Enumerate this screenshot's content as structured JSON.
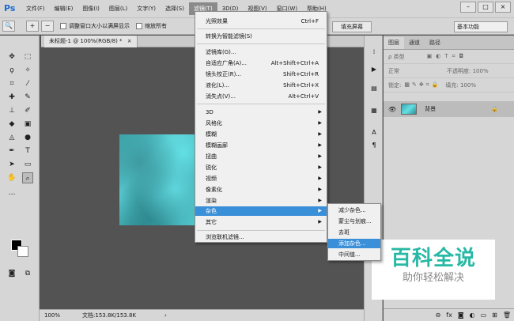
{
  "app": {
    "logo": "Ps",
    "menus": [
      "文件(F)",
      "编辑(E)",
      "图像(I)",
      "图层(L)",
      "文字(Y)",
      "选择(S)",
      "滤镜(T)",
      "3D(D)",
      "视图(V)",
      "窗口(W)",
      "帮助(H)"
    ],
    "active_menu": "滤镜(T)"
  },
  "options": {
    "check1": "调整窗口大小以满屏显示",
    "check2": "缩放所有",
    "fill_screen": "填充屏幕",
    "workspace": "基本功能"
  },
  "document": {
    "tab_label": "未标题-1 @ 100%(RGB/8) *",
    "tab_close": "×",
    "zoom": "100%",
    "doc_info": "文档:153.8K/153.8K"
  },
  "filter_menu": {
    "items": [
      {
        "label": "光照效果",
        "shortcut": "Ctrl+F"
      },
      {
        "label": "转换为智能滤镜(S)",
        "shortcut": ""
      },
      {
        "label": "滤镜库(G)...",
        "shortcut": ""
      },
      {
        "label": "自适应广角(A)...",
        "shortcut": "Alt+Shift+Ctrl+A"
      },
      {
        "label": "镜头校正(R)...",
        "shortcut": "Shift+Ctrl+R"
      },
      {
        "label": "液化(L)...",
        "shortcut": "Shift+Ctrl+X"
      },
      {
        "label": "消失点(V)...",
        "shortcut": "Alt+Ctrl+V"
      },
      {
        "label": "3D",
        "shortcut": ""
      },
      {
        "label": "风格化",
        "shortcut": ""
      },
      {
        "label": "模糊",
        "shortcut": ""
      },
      {
        "label": "模糊画廊",
        "shortcut": ""
      },
      {
        "label": "扭曲",
        "shortcut": ""
      },
      {
        "label": "锐化",
        "shortcut": ""
      },
      {
        "label": "视频",
        "shortcut": ""
      },
      {
        "label": "像素化",
        "shortcut": ""
      },
      {
        "label": "渲染",
        "shortcut": ""
      },
      {
        "label": "杂色",
        "shortcut": ""
      },
      {
        "label": "其它",
        "shortcut": ""
      },
      {
        "label": "浏览联机滤镜...",
        "shortcut": ""
      }
    ],
    "highlighted": "杂色"
  },
  "noise_submenu": {
    "items": [
      "减少杂色...",
      "蒙尘与划痕...",
      "去斑",
      "添加杂色...",
      "中间值..."
    ],
    "highlighted": "添加杂色..."
  },
  "layers_panel": {
    "tabs": [
      "图层",
      "通道",
      "路径"
    ],
    "kind_filter": "ρ 类型",
    "blend_mode": "正常",
    "opacity": "不透明度: 100%",
    "lock_label": "锁定:",
    "fill": "填充: 100%",
    "layer_name": "背景"
  },
  "watermark": {
    "main": "百科全说",
    "sub": "助你轻松解决"
  },
  "colors": {
    "accent": "#3a8fd9",
    "watermark": "#27b9a5"
  }
}
